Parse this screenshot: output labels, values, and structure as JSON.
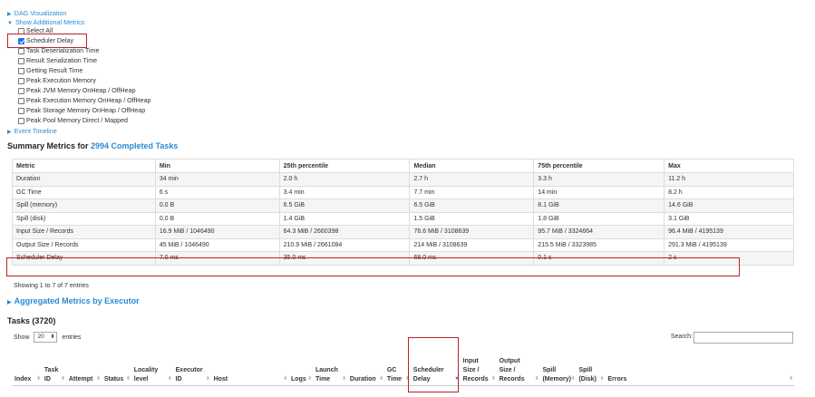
{
  "toggles": {
    "dag": "DAG Visualization",
    "additional": "Show Additional Metrics",
    "timeline": "Event Timeline",
    "aggregated": "Aggregated Metrics by Executor"
  },
  "metric_options": [
    {
      "label": "Select All",
      "checked": false
    },
    {
      "label": "Scheduler Delay",
      "checked": true
    },
    {
      "label": "Task Deserialization Time",
      "checked": false
    },
    {
      "label": "Result Serialization Time",
      "checked": false
    },
    {
      "label": "Getting Result Time",
      "checked": false
    },
    {
      "label": "Peak Execution Memory",
      "checked": false
    },
    {
      "label": "Peak JVM Memory OnHeap / OffHeap",
      "checked": false
    },
    {
      "label": "Peak Execution Memory OnHeap / OffHeap",
      "checked": false
    },
    {
      "label": "Peak Storage Memory OnHeap / OffHeap",
      "checked": false
    },
    {
      "label": "Peak Pool Memory Direct / Mapped",
      "checked": false
    }
  ],
  "summary": {
    "title_prefix": "Summary Metrics for ",
    "title_link": "2994 Completed Tasks",
    "headers": [
      "Metric",
      "Min",
      "25th percentile",
      "Median",
      "75th percentile",
      "Max"
    ],
    "rows": [
      [
        "Duration",
        "34 min",
        "2.0 h",
        "2.7 h",
        "3.3 h",
        "11.2 h"
      ],
      [
        "GC Time",
        "6 s",
        "3.4 min",
        "7.7 min",
        "14 min",
        "8.2 h"
      ],
      [
        "Spill (memory)",
        "0.0 B",
        "6.5 GiB",
        "6.5 GiB",
        "8.1 GiB",
        "14.6 GiB"
      ],
      [
        "Spill (disk)",
        "0.0 B",
        "1.4 GiB",
        "1.5 GiB",
        "1.8 GiB",
        "3.1 GiB"
      ],
      [
        "Input Size / Records",
        "16.9 MiB / 1046490",
        "64.3 MiB / 2660398",
        "76.6 MiB / 3108639",
        "95.7 MiB / 3324664",
        "96.4 MiB / 4195139"
      ],
      [
        "Output Size / Records",
        "45 MiB / 1046490",
        "210.9 MiB / 2661084",
        "214 MiB / 3108639",
        "215.5 MiB / 3323985",
        "291.3 MiB / 4195139"
      ],
      [
        "Scheduler Delay",
        "7.0 ms",
        "35.0 ms",
        "68.0 ms",
        "0.1 s",
        "2 s"
      ]
    ],
    "showing": "Showing 1 to 7 of 7 entries"
  },
  "tasks": {
    "title": "Tasks (3720)",
    "show_label": "Show",
    "page_size": "20",
    "entries_label": "entries",
    "search_label": "Search:",
    "columns": [
      [
        "Index"
      ],
      [
        "Task",
        "ID"
      ],
      [
        "Attempt"
      ],
      [
        "Status"
      ],
      [
        "Locality",
        "level"
      ],
      [
        "Executor",
        "ID"
      ],
      [
        "Host"
      ],
      [
        "Logs"
      ],
      [
        "Launch",
        "Time"
      ],
      [
        "Duration"
      ],
      [
        "GC",
        "Time"
      ],
      [
        "Scheduler",
        "Delay"
      ],
      [
        "Input",
        "Size /",
        "Records"
      ],
      [
        "Output",
        "Size /",
        "Records"
      ],
      [
        "Spill",
        "(Memory)"
      ],
      [
        "Spill",
        "(Disk)"
      ],
      [
        "Errors"
      ]
    ]
  }
}
